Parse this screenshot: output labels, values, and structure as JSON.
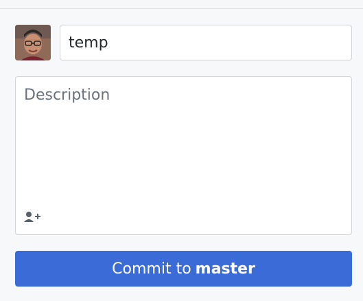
{
  "commit": {
    "summary_value": "temp",
    "description_placeholder": "Description",
    "button_prefix": "Commit to",
    "branch": "master"
  },
  "icons": {
    "avatar": "user-avatar",
    "coauthor": "add-coauthor-icon"
  },
  "colors": {
    "accent": "#3b6bd6",
    "background": "#f6f8fa",
    "border": "#d1d5da",
    "placeholder": "#6a737d"
  }
}
